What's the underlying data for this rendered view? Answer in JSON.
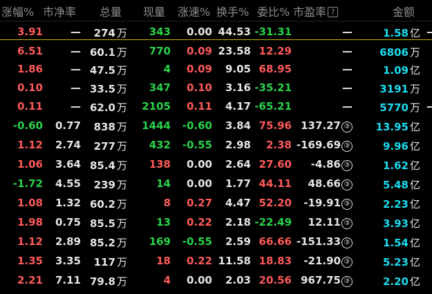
{
  "colors": {
    "up": "#ff5a5a",
    "down": "#29d34a",
    "neutral": "#e6e6e6",
    "amount": "#19dcf0",
    "header": "#8c8c8c",
    "separator": "#c8b400"
  },
  "headers": [
    "涨幅%",
    "市净率",
    "总量",
    "现量",
    "涨速%",
    "换手%",
    "委比%",
    "市盈率",
    "金额"
  ],
  "help_icon": "?",
  "rows": [
    {
      "zf": "3.91",
      "sjl": "—",
      "zl": "274",
      "zl_u": "万",
      "xl": "343",
      "zs": "0.00",
      "hs": "44.53",
      "wb": "-31.31",
      "syl": "—",
      "syl_m": "",
      "je": "1.58",
      "je_u": "亿",
      "tail": "—",
      "zfc": "red",
      "xlc": "green",
      "zsc": "white",
      "wbc": "green"
    },
    {
      "zf": "6.51",
      "sjl": "—",
      "zl": "60.1",
      "zl_u": "万",
      "xl": "770",
      "zs": "0.09",
      "hs": "23.58",
      "wb": "12.29",
      "syl": "—",
      "syl_m": "",
      "je": "6806",
      "je_u": "万",
      "tail": "",
      "zfc": "red",
      "xlc": "green",
      "zsc": "red",
      "wbc": "red"
    },
    {
      "zf": "1.86",
      "sjl": "—",
      "zl": "47.5",
      "zl_u": "万",
      "xl": "4",
      "zs": "0.09",
      "hs": "9.05",
      "wb": "68.95",
      "syl": "—",
      "syl_m": "",
      "je": "1.09",
      "je_u": "亿",
      "tail": "",
      "zfc": "red",
      "xlc": "green",
      "zsc": "red",
      "wbc": "red"
    },
    {
      "zf": "0.10",
      "sjl": "—",
      "zl": "33.5",
      "zl_u": "万",
      "xl": "347",
      "zs": "0.10",
      "hs": "3.16",
      "wb": "-35.21",
      "syl": "—",
      "syl_m": "",
      "je": "3191",
      "je_u": "万",
      "tail": "",
      "zfc": "red",
      "xlc": "green",
      "zsc": "red",
      "wbc": "green"
    },
    {
      "zf": "0.11",
      "sjl": "—",
      "zl": "62.0",
      "zl_u": "万",
      "xl": "2105",
      "zs": "0.11",
      "hs": "4.17",
      "wb": "-65.21",
      "syl": "—",
      "syl_m": "",
      "je": "5770",
      "je_u": "万",
      "tail": "—",
      "zfc": "red",
      "xlc": "green",
      "zsc": "red",
      "wbc": "green"
    },
    {
      "zf": "-0.60",
      "sjl": "0.77",
      "zl": "838",
      "zl_u": "万",
      "xl": "1444",
      "zs": "-0.60",
      "hs": "3.84",
      "wb": "75.96",
      "syl": "137.27",
      "syl_m": "③",
      "je": "13.95",
      "je_u": "亿",
      "tail": "",
      "zfc": "green",
      "xlc": "green",
      "zsc": "green",
      "wbc": "red"
    },
    {
      "zf": "1.12",
      "sjl": "2.74",
      "zl": "277",
      "zl_u": "万",
      "xl": "432",
      "zs": "-0.55",
      "hs": "2.98",
      "wb": "2.38",
      "syl": "-169.69",
      "syl_m": "③",
      "je": "9.96",
      "je_u": "亿",
      "tail": "",
      "zfc": "red",
      "xlc": "green",
      "zsc": "green",
      "wbc": "red"
    },
    {
      "zf": "1.06",
      "sjl": "3.64",
      "zl": "85.4",
      "zl_u": "万",
      "xl": "138",
      "zs": "0.00",
      "hs": "2.64",
      "wb": "27.60",
      "syl": "-4.86",
      "syl_m": "③",
      "je": "1.62",
      "je_u": "亿",
      "tail": "",
      "zfc": "red",
      "xlc": "red",
      "zsc": "white",
      "wbc": "red"
    },
    {
      "zf": "-1.72",
      "sjl": "4.55",
      "zl": "239",
      "zl_u": "万",
      "xl": "14",
      "zs": "0.00",
      "hs": "1.77",
      "wb": "44.11",
      "syl": "48.66",
      "syl_m": "③",
      "je": "5.48",
      "je_u": "亿",
      "tail": "",
      "zfc": "green",
      "xlc": "green",
      "zsc": "white",
      "wbc": "red"
    },
    {
      "zf": "1.08",
      "sjl": "1.32",
      "zl": "60.2",
      "zl_u": "万",
      "xl": "8",
      "zs": "0.27",
      "hs": "4.47",
      "wb": "52.20",
      "syl": "-19.91",
      "syl_m": "③",
      "je": "2.23",
      "je_u": "亿",
      "tail": "",
      "zfc": "red",
      "xlc": "red",
      "zsc": "red",
      "wbc": "red"
    },
    {
      "zf": "1.98",
      "sjl": "0.75",
      "zl": "85.5",
      "zl_u": "万",
      "xl": "13",
      "zs": "0.22",
      "hs": "2.18",
      "wb": "-22.49",
      "syl": "12.11",
      "syl_m": "③",
      "je": "3.93",
      "je_u": "亿",
      "tail": "",
      "zfc": "red",
      "xlc": "green",
      "zsc": "red",
      "wbc": "green"
    },
    {
      "zf": "1.12",
      "sjl": "2.89",
      "zl": "85.2",
      "zl_u": "万",
      "xl": "169",
      "zs": "-0.55",
      "hs": "2.59",
      "wb": "66.66",
      "syl": "-151.33",
      "syl_m": "③",
      "je": "1.54",
      "je_u": "亿",
      "tail": "",
      "zfc": "red",
      "xlc": "green",
      "zsc": "green",
      "wbc": "red"
    },
    {
      "zf": "1.35",
      "sjl": "3.35",
      "zl": "117",
      "zl_u": "万",
      "xl": "18",
      "zs": "0.22",
      "hs": "11.58",
      "wb": "18.83",
      "syl": "-21.90",
      "syl_m": "③",
      "je": "5.23",
      "je_u": "亿",
      "tail": "",
      "zfc": "red",
      "xlc": "red",
      "zsc": "red",
      "wbc": "red"
    },
    {
      "zf": "2.21",
      "sjl": "7.11",
      "zl": "79.8",
      "zl_u": "万",
      "xl": "4",
      "zs": "0.00",
      "hs": "2.03",
      "wb": "20.56",
      "syl": "967.75",
      "syl_m": "③",
      "je": "2.20",
      "je_u": "亿",
      "tail": "",
      "zfc": "red",
      "xlc": "red",
      "zsc": "white",
      "wbc": "red"
    }
  ]
}
